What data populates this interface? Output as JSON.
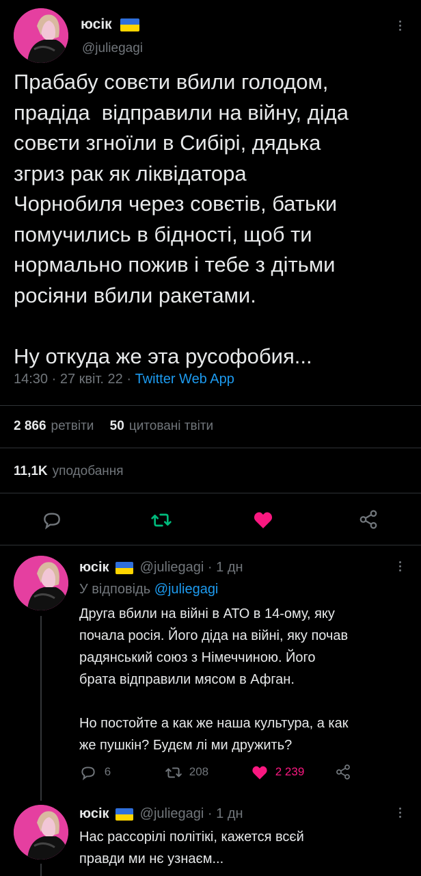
{
  "main_tweet": {
    "author_name": "юсік",
    "handle": "@juliegagi",
    "text": "Прабабу совєти вбили голодом,\nпрадіда  відправили на війну, діда\nсовєти згноїли в Сибірі, дядька\nзгриз рак як ліквідатора\nЧорнобиля через совєтів, батьки\nпомучились в бідності, щоб ти\nнормально пожив і тебе з дітьми\nросіяни вбили ракетами.\n\nНу откуда же эта русофобия...",
    "time": "14:30",
    "date": "27 квіт. 22",
    "source": "Twitter Web App",
    "sep": "·",
    "retweets_count": "2 866",
    "retweets_label": "ретвіти",
    "quotes_count": "50",
    "quotes_label": "цитовані твіти",
    "likes_count": "11,1K",
    "likes_label": "уподобання"
  },
  "replies": [
    {
      "author_name": "юсік",
      "handle": "@juliegagi",
      "time_ago": "1 дн",
      "sep": "·",
      "reply_to_label": "У відповідь",
      "reply_to_handle": "@juliegagi",
      "text": "Друга вбили на війні в АТО в 14-ому, яку\nпочала росія. Його діда на війні, яку почав\nрадянський союз з Німеччиною. Його\nбрата відправили мясом в Афган.\n\nНо постойте а как же наша культура, а как\nже пушкін? Будєм лі ми дружить?",
      "reply_count": "6",
      "retweet_count": "208",
      "like_count": "2 239"
    },
    {
      "author_name": "юсік",
      "handle": "@juliegagi",
      "time_ago": "1 дн",
      "sep": "·",
      "text": "Нас рассорілі політікі, кажется всєй\nправди ми нє узнаєм..."
    }
  ],
  "colors": {
    "background": "#000000",
    "text": "#e7e9ea",
    "muted": "#71767b",
    "link": "#1d9bf0",
    "retweet_green": "#00ba7c",
    "like_pink": "#f91880",
    "flag_blue": "#2f6fdb",
    "flag_yellow": "#ffd500"
  },
  "icons": [
    "reply-icon",
    "retweet-icon",
    "like-icon",
    "share-icon",
    "more-icon",
    "ukraine-flag-icon"
  ]
}
